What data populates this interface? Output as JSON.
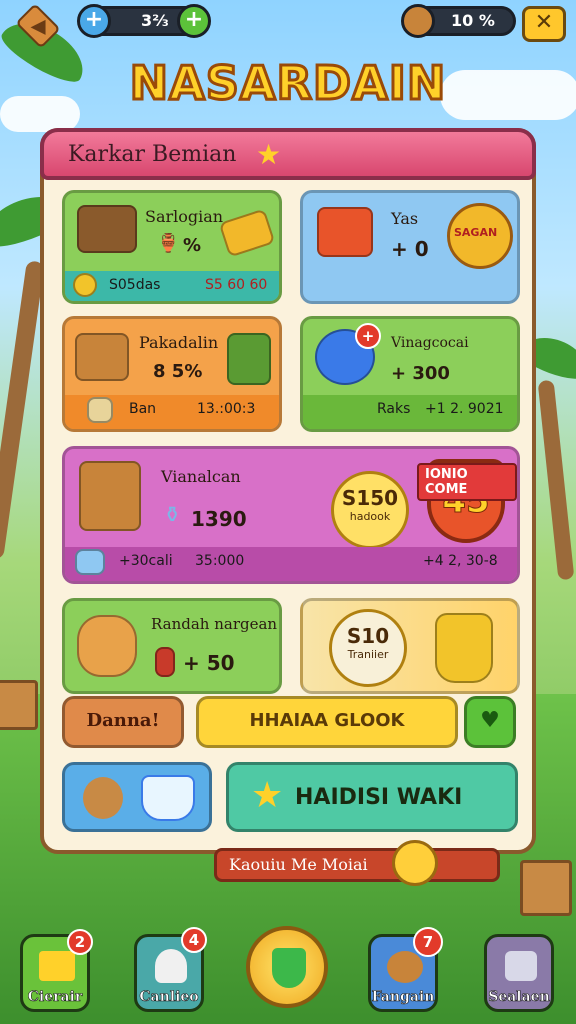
{
  "top_bar": {
    "currency_value": "3⅔",
    "resource_value": "10 %",
    "add_icon": "plus-icon",
    "close_icon": "close-icon"
  },
  "game_title": "NASARDAIN",
  "panel": {
    "header": "Karkar Bemian",
    "cards": {
      "c1": {
        "title": "Sarlogian",
        "value": "%",
        "strip_left": "S05das",
        "strip_right": "S5 60 60"
      },
      "c2": {
        "title": "Yas",
        "value": "+ 0",
        "seal": "SAGAN"
      },
      "c3": {
        "title": "Pakadalin",
        "value": "8 5%",
        "strip_left": "Ban",
        "strip_right": "13.:00:3"
      },
      "c4": {
        "title": "Vinagcocai",
        "value": "+ 300",
        "strip_left": "Raks",
        "strip_right": "+1 2. 9021",
        "badge": "+"
      },
      "c5": {
        "title": "Vianalcan",
        "value": "1390",
        "burst_a": "S150",
        "burst_b": "hadook",
        "ribbon": "IONIO COME",
        "shield": "45",
        "strip_left": "+30cali",
        "strip_mid": "35:000",
        "strip_right": "+4 2, 30-8"
      },
      "c6": {
        "title": "Randah nargean",
        "value": "+ 50"
      },
      "c7": {
        "burst_a": "S10",
        "burst_b": "Traniier"
      }
    },
    "buttons": {
      "small": "Danna!",
      "main": "HHAIAA GLOOK",
      "wide": "HAIDISI WAKI"
    }
  },
  "footer_banner": "Kaouiu Me Moiai",
  "bottom_nav": [
    {
      "label": "Cierair",
      "badge": "2"
    },
    {
      "label": "Canlieo",
      "badge": "4"
    },
    {
      "label": "Fangain",
      "badge": "7"
    },
    {
      "label": "Sealaen",
      "badge": ""
    }
  ],
  "colors": {
    "title_gold": "#ffd12a",
    "panel_header": "#d8476f",
    "card_green": "#8ccf5a",
    "card_blue": "#8fc8f2",
    "card_orange": "#f4a24a",
    "card_magenta": "#d870c8",
    "button_yellow": "#ffd53a",
    "button_teal": "#4fc9a4"
  }
}
